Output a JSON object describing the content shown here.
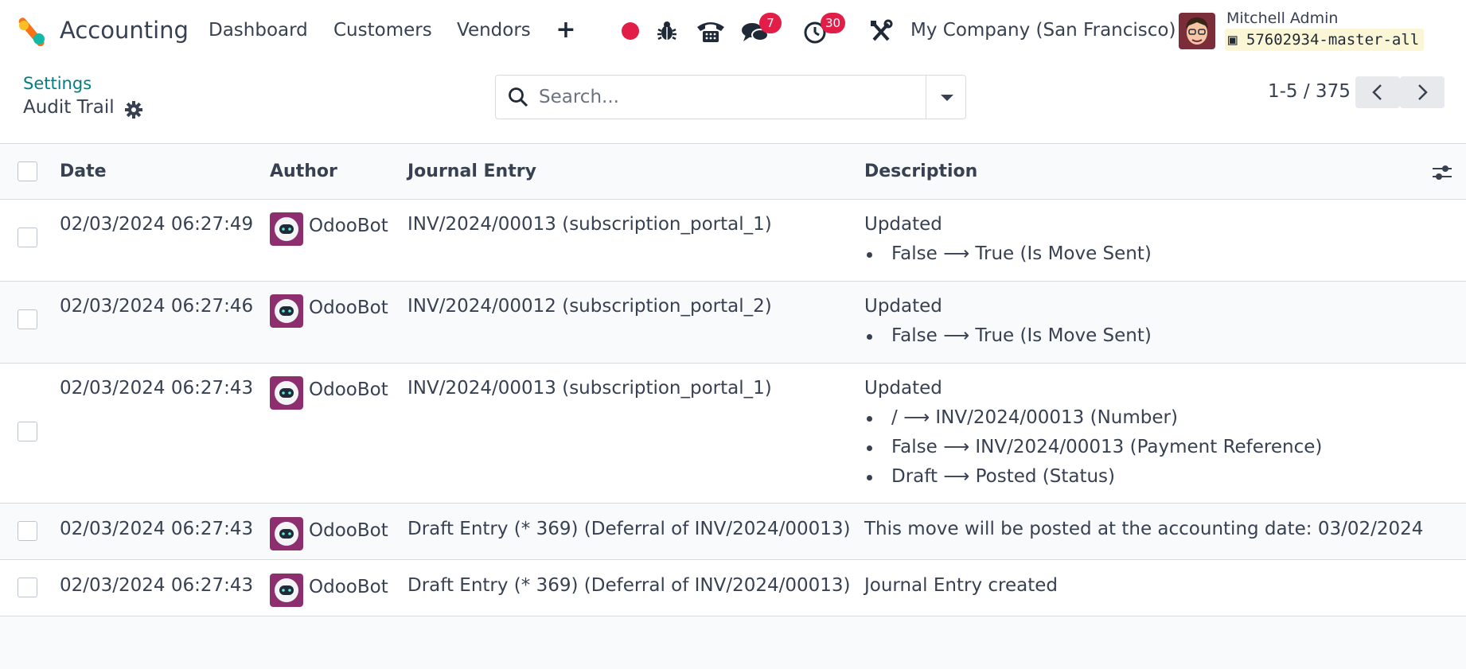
{
  "navbar": {
    "app_name": "Accounting",
    "menu": [
      "Dashboard",
      "Customers",
      "Vendors"
    ],
    "messages_count": "7",
    "activities_count": "30",
    "company": "My Company (San Francisco)",
    "user_name": "Mitchell Admin",
    "database": "57602934-master-all"
  },
  "control": {
    "breadcrumb_parent": "Settings",
    "page_title": "Audit Trail",
    "search_placeholder": "Search...",
    "pager": "1-5 / 375"
  },
  "table": {
    "headers": {
      "date": "Date",
      "author": "Author",
      "journal_entry": "Journal Entry",
      "description": "Description"
    },
    "rows": [
      {
        "date": "02/03/2024 06:27:49",
        "author": "OdooBot",
        "entry": "INV/2024/00013 (subscription_portal_1)",
        "description": "Updated",
        "changes": [
          {
            "old": "False",
            "new": "True (Is Move Sent)"
          }
        ]
      },
      {
        "date": "02/03/2024 06:27:46",
        "author": "OdooBot",
        "entry": "INV/2024/00012 (subscription_portal_2)",
        "description": "Updated",
        "changes": [
          {
            "old": "False",
            "new": "True (Is Move Sent)"
          }
        ]
      },
      {
        "date": "02/03/2024 06:27:43",
        "author": "OdooBot",
        "entry": "INV/2024/00013 (subscription_portal_1)",
        "description": "Updated",
        "changes": [
          {
            "old": "/",
            "new": "INV/2024/00013 (Number)"
          },
          {
            "old": "False",
            "new": "INV/2024/00013 (Payment Reference)"
          },
          {
            "old": "Draft",
            "new": "Posted (Status)"
          }
        ]
      },
      {
        "date": "02/03/2024 06:27:43",
        "author": "OdooBot",
        "entry": "Draft Entry (* 369) (Deferral of INV/2024/00013)",
        "description": "This move will be posted at the accounting date: 03/02/2024",
        "changes": []
      },
      {
        "date": "02/03/2024 06:27:43",
        "author": "OdooBot",
        "entry": "Draft Entry (* 369) (Deferral of INV/2024/00013)",
        "description": "Journal Entry created",
        "changes": []
      }
    ]
  },
  "colors": {
    "accent": "#017e84",
    "badge": "#e11d48",
    "brand_orange": "#f97316",
    "brand_teal": "#14b8a6"
  }
}
